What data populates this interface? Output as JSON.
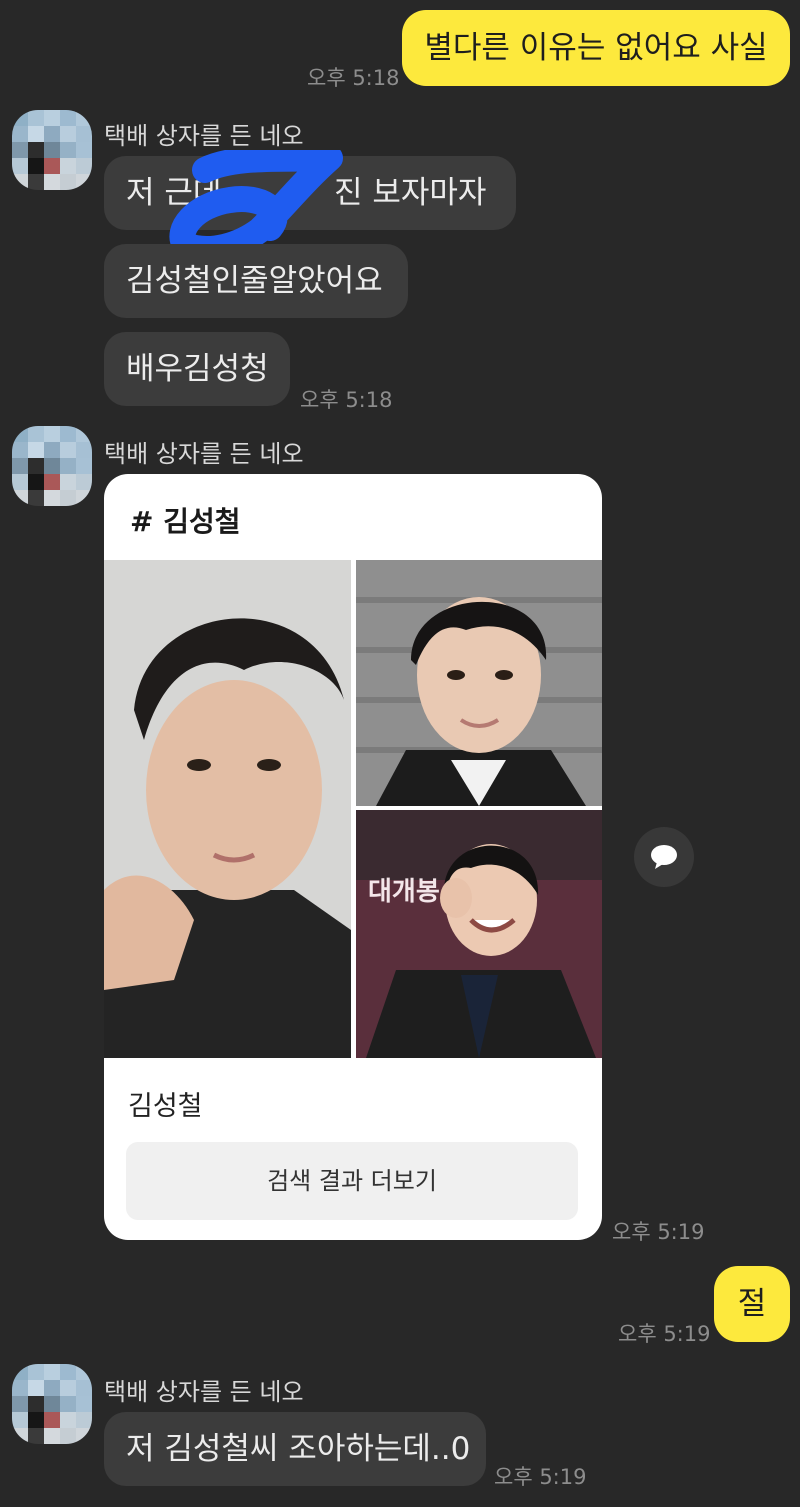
{
  "colors": {
    "background": "#282828",
    "incoming_bubble": "#3c3c3c",
    "outgoing_bubble": "#fde93d",
    "card": "#ffffff"
  },
  "messages": [
    {
      "id": "m1",
      "side": "out",
      "text": "별다른 이유는 없어요 사실",
      "time": "오후 5:18"
    },
    {
      "id": "m2",
      "side": "in",
      "sender": "택배 상자를 든 네오",
      "bubbles": [
        "저 근데",
        "진 보자마자",
        "김성철인줄알았어요",
        "배우김성청"
      ],
      "time": "오후 5:18"
    },
    {
      "id": "m3",
      "side": "in",
      "sender": "택배 상자를 든 네오",
      "time": "오후 5:19",
      "card": {
        "hashtag": "# 김성철",
        "result_name": "김성철",
        "more_button": "검색 결과 더보기"
      }
    },
    {
      "id": "m4",
      "side": "out",
      "text": "절",
      "time": "오후 5:19"
    },
    {
      "id": "m5",
      "side": "in",
      "sender": "택배 상자를 든 네오",
      "bubbles": [
        "저 김성철씨 조아하는데..0"
      ],
      "time": "오후 5:19"
    }
  ],
  "icons": {
    "share": "speech-bubble-icon"
  }
}
